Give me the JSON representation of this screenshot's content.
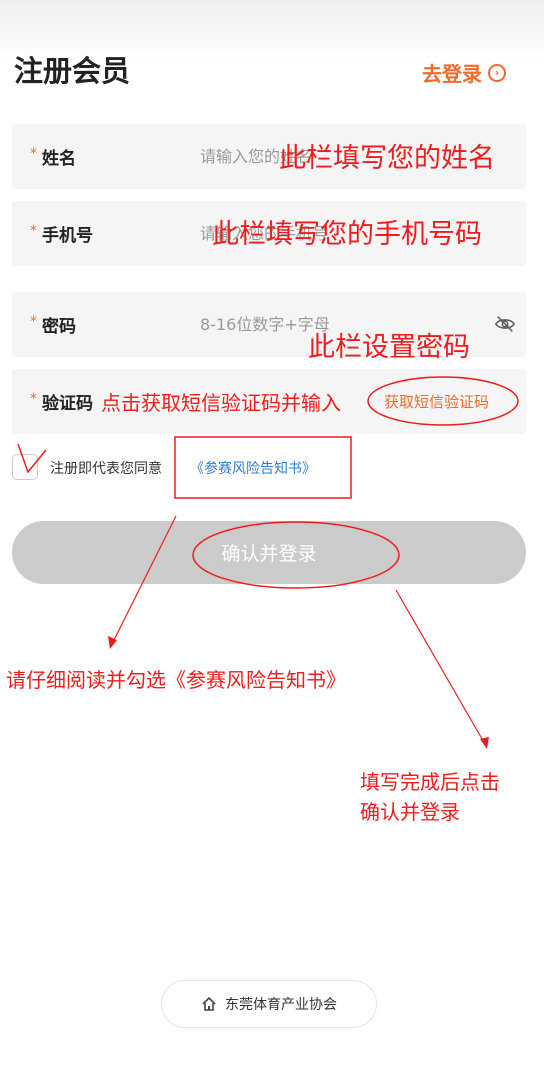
{
  "header": {
    "title": "注册会员",
    "login_link": "去登录"
  },
  "form": {
    "name": {
      "required_mark": "*",
      "label": "姓名",
      "placeholder": "请输入您的姓名"
    },
    "phone": {
      "required_mark": "*",
      "label": "手机号",
      "placeholder": "请输入您的手机号"
    },
    "password": {
      "required_mark": "*",
      "label": "密码",
      "placeholder": "8-16位数字+字母",
      "icon": "eye-off-icon"
    },
    "code": {
      "required_mark": "*",
      "label": "验证码",
      "sms_button": "获取短信验证码"
    }
  },
  "agreement": {
    "checked": false,
    "text": "注册即代表您同意",
    "link": "《参赛风险告知书》"
  },
  "confirm_button": "确认并登录",
  "footer": {
    "org": "东莞体育产业协会",
    "icon": "home-icon"
  },
  "annotations": {
    "name_hint": "此栏填写您的姓名",
    "phone_hint": "此栏填写您的手机号码",
    "password_hint": "此栏设置密码",
    "code_hint": "点击获取短信验证码并输入",
    "agreement_hint": "请仔细阅读并勾选《参赛风险告知书》",
    "confirm_hint_line1": "填写完成后点击",
    "confirm_hint_line2": "确认并登录"
  },
  "colors": {
    "accent": "#f06a2a",
    "link": "#2f7fd6",
    "annotation": "#ee1c1c",
    "button_disabled": "#cbcbcb"
  }
}
